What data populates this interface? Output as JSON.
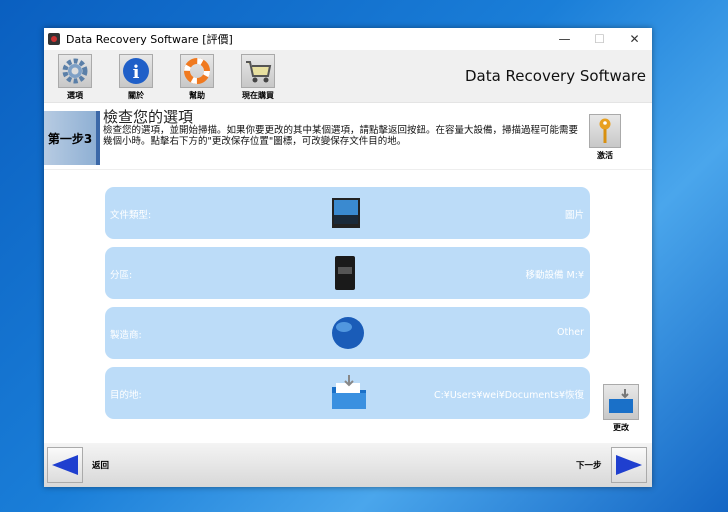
{
  "window": {
    "title": "Data Recovery Software [評價]",
    "minimize": "—",
    "maximize": "☐",
    "close": "✕"
  },
  "toolbar": {
    "items": [
      {
        "label": "選項",
        "icon": "gear-icon"
      },
      {
        "label": "關於",
        "icon": "info-icon"
      },
      {
        "label": "幫助",
        "icon": "lifebuoy-icon"
      },
      {
        "label": "現在購買",
        "icon": "cart-icon"
      }
    ],
    "brand": "Data Recovery Software"
  },
  "header": {
    "step": "第一步3",
    "title": "檢查您的選項",
    "description": "檢查您的選項，並開始掃描。如果你要更改的其中某個選項，請點擊返回按鈕。在容量大設備，掃描過程可能需要幾個小時。點擊右下方的\"更改保存位置\"圖標，可改變保存文件目的地。",
    "activate_label": "激活"
  },
  "summary": [
    {
      "label": "文件類型:",
      "value": "圖片",
      "icon": "photo-icon"
    },
    {
      "label": "分區:",
      "value": "移動設備 M:¥",
      "icon": "device-icon"
    },
    {
      "label": "製造商:",
      "value": "Other",
      "icon": "globe-icon"
    },
    {
      "label": "目的地:",
      "value": "C:¥Users¥wei¥Documents¥恢復",
      "icon": "folder-icon"
    }
  ],
  "change_label": "更改",
  "footer": {
    "back": "返回",
    "next": "下一步"
  },
  "colors": {
    "row": "#bcdcf8",
    "accent": "#1f3fcf"
  }
}
